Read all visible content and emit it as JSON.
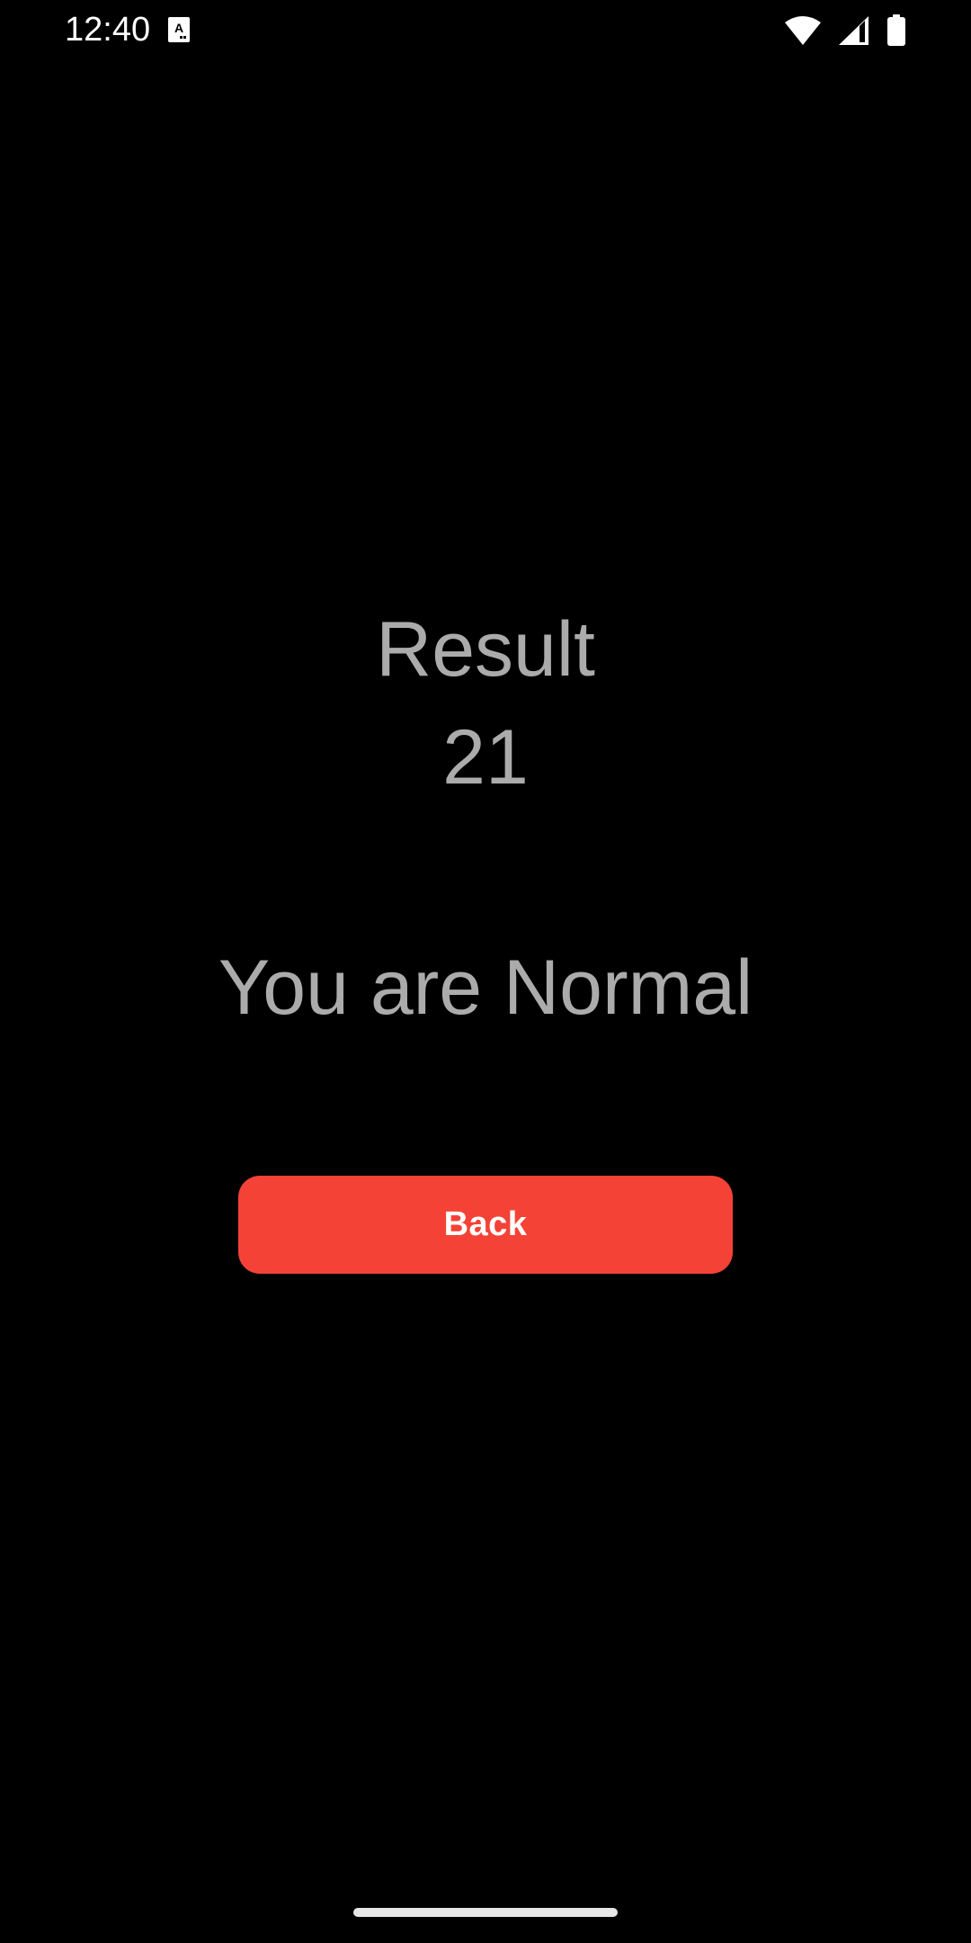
{
  "status_bar": {
    "time": "12:40",
    "icons": [
      "notification-a-icon",
      "wifi-icon",
      "signal-icon",
      "battery-icon"
    ]
  },
  "result": {
    "label": "Result",
    "value": "21",
    "message": "You are Normal"
  },
  "actions": {
    "back_label": "Back"
  },
  "colors": {
    "background": "#000000",
    "text": "#ababab",
    "button": "#f44336",
    "button_text": "#ffffff"
  }
}
